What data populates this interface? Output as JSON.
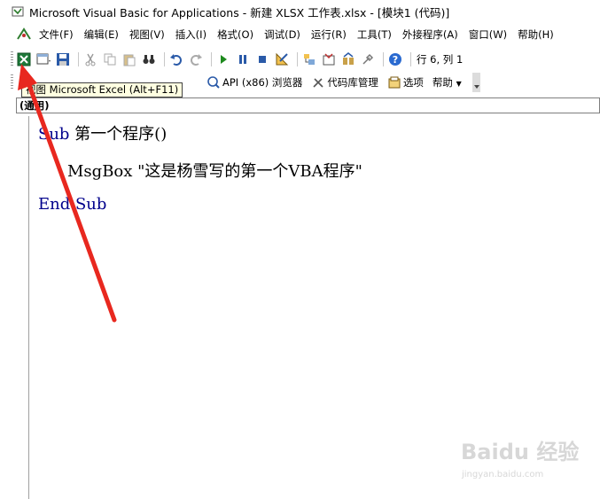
{
  "window": {
    "title": "Microsoft Visual Basic for Applications - 新建 XLSX 工作表.xlsx - [模块1 (代码)]"
  },
  "menubar": {
    "items": [
      {
        "label": "文件(F)"
      },
      {
        "label": "编辑(E)"
      },
      {
        "label": "视图(V)"
      },
      {
        "label": "插入(I)"
      },
      {
        "label": "格式(O)"
      },
      {
        "label": "调试(D)"
      },
      {
        "label": "运行(R)"
      },
      {
        "label": "工具(T)"
      },
      {
        "label": "外接程序(A)"
      },
      {
        "label": "窗口(W)"
      },
      {
        "label": "帮助(H)"
      }
    ]
  },
  "toolbar_standard": {
    "cursor_position": "行 6, 列 1",
    "icons": [
      "excel-icon",
      "insert-module-icon",
      "save-icon",
      "cut-icon",
      "copy-icon",
      "paste-icon",
      "find-icon",
      "undo-icon",
      "redo-icon",
      "run-icon",
      "break-icon",
      "reset-icon",
      "design-mode-icon",
      "project-explorer-icon",
      "properties-icon",
      "object-browser-icon",
      "toolbox-icon",
      "help-icon"
    ]
  },
  "toolbar_custom": {
    "items": [
      {
        "label": "API (x86) 浏览器"
      },
      {
        "label": "代码库管理"
      },
      {
        "label": "选项"
      },
      {
        "label": "帮助"
      }
    ]
  },
  "tooltip": {
    "text": "视图 Microsoft Excel (Alt+F11)"
  },
  "object_combo": {
    "value": "(通用)"
  },
  "code": {
    "line1": {
      "kw": "Sub",
      "rest": " 第一个程序()"
    },
    "line2": {
      "text": "MsgBox \"这是杨雪写的第一个VBA程序\""
    },
    "line3": {
      "kw": "End Sub"
    }
  },
  "watermark": {
    "main": "Baidu 经验",
    "sub": "jingyan.baidu.com"
  },
  "colors": {
    "keyword": "#00008b",
    "annotation_arrow": "#e8281f",
    "tooltip_bg": "#ffffe1"
  }
}
